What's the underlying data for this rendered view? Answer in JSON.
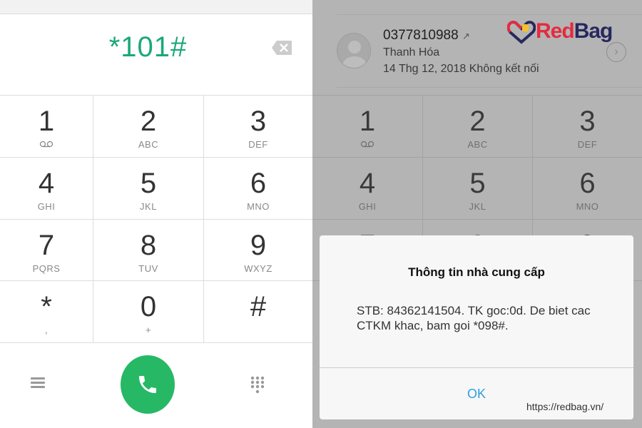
{
  "dialer": {
    "dialed_number": "*101#",
    "keys": [
      {
        "digit": "1",
        "letters": "voicemail"
      },
      {
        "digit": "2",
        "letters": "ABC"
      },
      {
        "digit": "3",
        "letters": "DEF"
      },
      {
        "digit": "4",
        "letters": "GHI"
      },
      {
        "digit": "5",
        "letters": "JKL"
      },
      {
        "digit": "6",
        "letters": "MNO"
      },
      {
        "digit": "7",
        "letters": "PQRS"
      },
      {
        "digit": "8",
        "letters": "TUV"
      },
      {
        "digit": "9",
        "letters": "WXYZ"
      },
      {
        "digit": "*",
        "letters": ","
      },
      {
        "digit": "0",
        "letters": "+"
      },
      {
        "digit": "#",
        "letters": ""
      }
    ],
    "call_color": "#27b866",
    "accent": "#1aa876"
  },
  "call_log": {
    "number": "0377810988",
    "location": "Thanh Hóa",
    "detail": "14 Thg 12, 2018 Không kết nối"
  },
  "watermark": {
    "logo_text": "RedBag",
    "url": "https://redbag.vn/"
  },
  "dialog": {
    "title": "Thông tin nhà cung cấp",
    "message": "STB: 84362141504. TK goc:0d. De biet cac CTKM khac, bam goi *098#.",
    "ok_label": "OK"
  }
}
